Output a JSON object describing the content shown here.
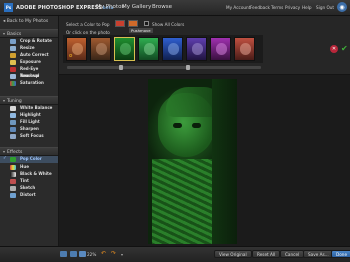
{
  "app": {
    "logo_badge": "Ps",
    "logo_text": "ADOBE PHOTOSHOP EXPRESS",
    "logo_beta": "beta",
    "nav": [
      "My Photos",
      "My Gallery",
      "Browse"
    ],
    "account": [
      "My Account",
      "Feedback",
      "Terms",
      "Privacy",
      "Help",
      "Sign Out"
    ]
  },
  "sidebar": {
    "back_label": "Back to My Photos",
    "sections": [
      {
        "title": "Basics",
        "items": [
          "Crop & Rotate",
          "Resize",
          "Auto Correct",
          "Exposure",
          "Red-Eye Removal",
          "Touchup",
          "Saturation"
        ]
      },
      {
        "title": "Tuning",
        "items": [
          "White Balance",
          "Highlight",
          "Fill Light",
          "Sharpen",
          "Soft Focus"
        ]
      },
      {
        "title": "Effects",
        "items": [
          "Pop Color",
          "Hue",
          "Black & White",
          "Tint",
          "Sketch",
          "Distort"
        ]
      }
    ],
    "selected_item": "Pop Color"
  },
  "options": {
    "select_label": "Select a Color to Pop",
    "show_all_label": "Show All Colors",
    "click_label": "Or click on the photo",
    "tooltip": "Pushmove",
    "swatch_colors": [
      "#c8402f",
      "#d06a2a"
    ],
    "thumb_tints": [
      "#c0602f",
      "#a05a30",
      "#1f8f2f",
      "#2fae50",
      "#2f5fd0",
      "#5f3fb0",
      "#a030b0",
      "#c05040"
    ],
    "selected_thumb": 2
  },
  "bottom": {
    "zoom_label": "22%",
    "buttons": {
      "view_original": "View Original",
      "reset_all": "Reset All",
      "cancel": "Cancel",
      "save_as": "Save As...",
      "done": "Done"
    }
  }
}
